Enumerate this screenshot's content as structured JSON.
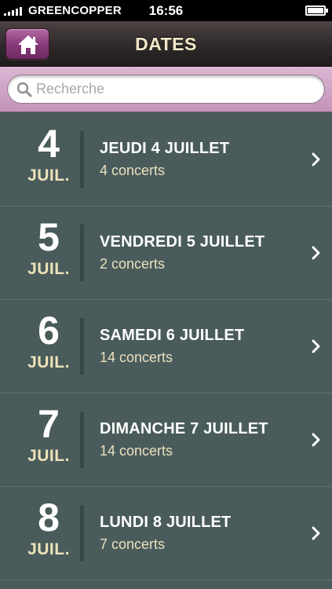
{
  "status_bar": {
    "carrier": "GREENCOPPER",
    "time": "16:56",
    "battery_level": 1.0
  },
  "navbar": {
    "title": "DATES",
    "home_icon": "home-icon"
  },
  "search": {
    "placeholder": "Recherche",
    "value": "",
    "icon": "magnifier-icon"
  },
  "colors": {
    "nav_accent": "#8a3a7a",
    "search_bar": "#c393b8",
    "list_background": "#4a5b5b",
    "title_text": "#f1e9c9",
    "month_text": "#ece3b9"
  },
  "dates": [
    {
      "day": "4",
      "month": "JUIL.",
      "title": "JEUDI 4 JUILLET",
      "subtitle": "4 concerts"
    },
    {
      "day": "5",
      "month": "JUIL.",
      "title": "VENDREDI 5 JUILLET",
      "subtitle": "2 concerts"
    },
    {
      "day": "6",
      "month": "JUIL.",
      "title": "SAMEDI 6 JUILLET",
      "subtitle": "14 concerts"
    },
    {
      "day": "7",
      "month": "JUIL.",
      "title": "DIMANCHE 7 JUILLET",
      "subtitle": "14 concerts"
    },
    {
      "day": "8",
      "month": "JUIL.",
      "title": "LUNDI 8 JUILLET",
      "subtitle": "7 concerts"
    }
  ]
}
